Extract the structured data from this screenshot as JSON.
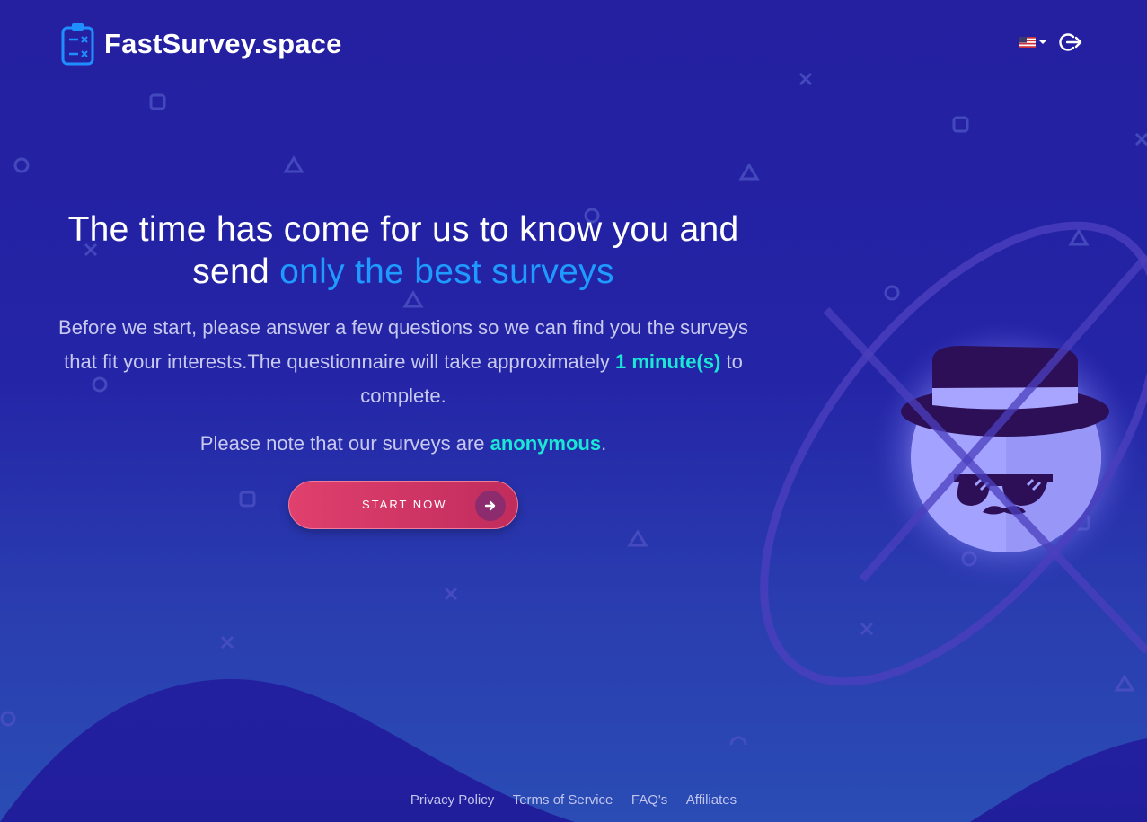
{
  "brand": {
    "title": "FastSurvey.space"
  },
  "header": {
    "language": "US",
    "logout_icon": "logout-icon"
  },
  "hero": {
    "headline_part1": "The time has come for us to know you and send",
    "headline_highlight": "only the best surveys",
    "intro_part1": "Before we start, please answer a few questions so we can find you the surveys that fit your interests.The questionnaire will take approximately",
    "intro_highlight": "1 minute(s)",
    "intro_part2": "to complete.",
    "note_part1": "Please note that our surveys are",
    "note_highlight": "anonymous",
    "note_part2": "."
  },
  "cta": {
    "label": "START NOW",
    "icon": "arrow-right-icon"
  },
  "footer": {
    "links": [
      "Privacy Policy",
      "Terms of Service",
      "FAQ's",
      "Affiliates"
    ]
  },
  "colors": {
    "background": "#2420a0",
    "highlight_blue": "#1f9bff",
    "highlight_teal": "#1be8d4",
    "cta": "#d83a68"
  }
}
